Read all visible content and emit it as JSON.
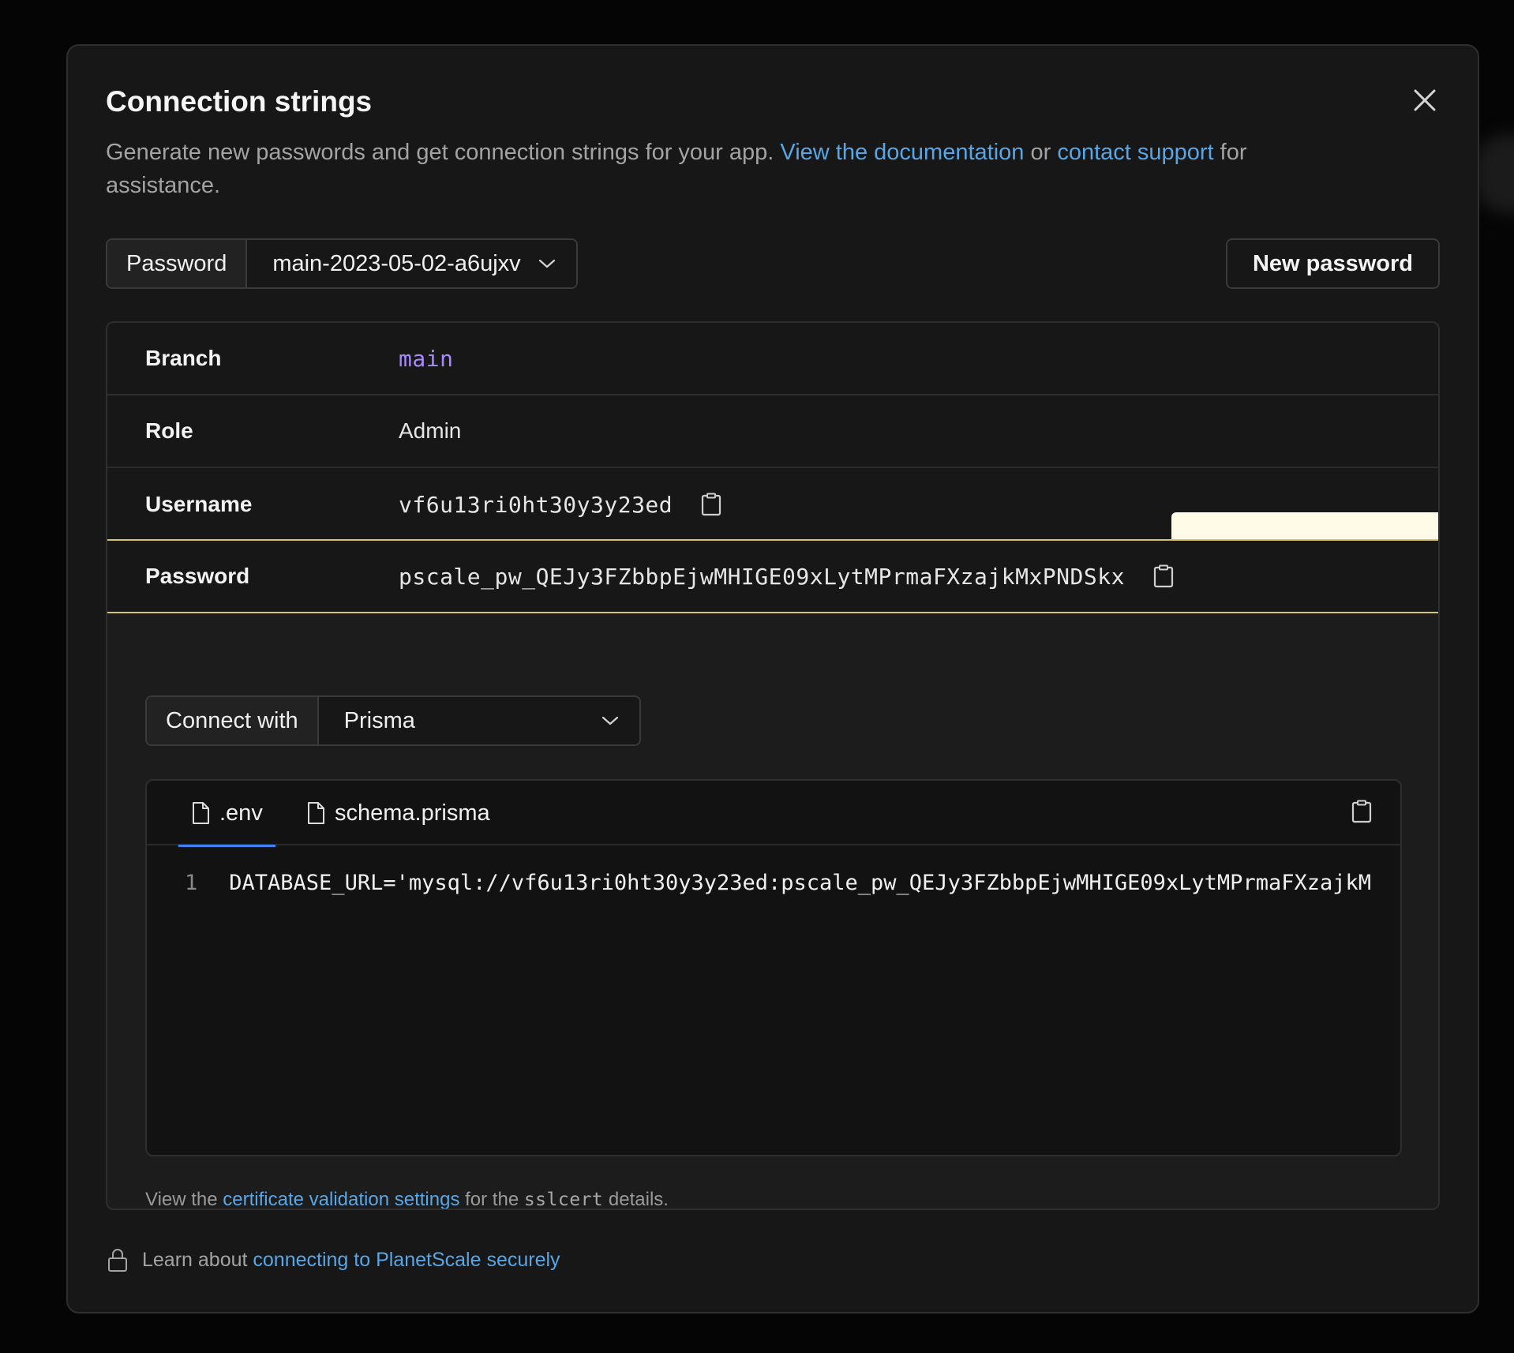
{
  "modal": {
    "title": "Connection strings",
    "subtitle_prefix": "Generate new passwords and get connection strings for your app. ",
    "docs_link": "View the documentation",
    "subtitle_mid": " or ",
    "support_link": "contact support",
    "subtitle_suffix": " for assistance."
  },
  "password_select": {
    "label": "Password",
    "value": "main-2023-05-02-a6ujxv"
  },
  "new_password_button": "New password",
  "details": {
    "branch_label": "Branch",
    "branch_value": "main",
    "role_label": "Role",
    "role_value": "Admin",
    "username_label": "Username",
    "username_value": "vf6u13ri0ht30y3y23ed",
    "password_label": "Password",
    "password_value": "pscale_pw_QEJy3FZbbpEjwMHIGE09xLytMPrmaFXzajkMxPNDSkx"
  },
  "connect_with": {
    "label": "Connect with",
    "value": "Prisma"
  },
  "code": {
    "tabs": [
      ".env",
      "schema.prisma"
    ],
    "active_tab": ".env",
    "line_number": "1",
    "line_text": "DATABASE_URL='mysql://vf6u13ri0ht30y3y23ed:pscale_pw_QEJy3FZbbpEjwMHIGE09xLytMPrmaFXzajkM"
  },
  "cert_note": {
    "prefix": "View the ",
    "link": "certificate validation settings",
    "mid": " for the ",
    "code": "sslcert",
    "suffix": " details."
  },
  "footer": {
    "prefix": "Learn about ",
    "link": "connecting to PlanetScale securely"
  },
  "colors": {
    "link": "#58a6e6",
    "branch": "#a78bfa",
    "highlight_border": "#d9c56a",
    "active_tab": "#3b82f6"
  },
  "icons": [
    "close-icon",
    "chevron-down-icon",
    "clipboard-icon",
    "file-icon",
    "lock-icon"
  ]
}
